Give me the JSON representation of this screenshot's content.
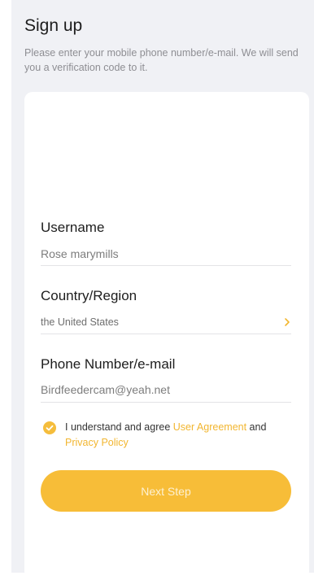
{
  "header": {
    "title": "Sign up",
    "subtitle": "Please enter your mobile phone number/e-mail. We will send you a verification code to it."
  },
  "form": {
    "username": {
      "label": "Username",
      "value": "Rose marymills"
    },
    "country": {
      "label": "Country/Region",
      "value": "the United States",
      "icon": "chevron-right-icon"
    },
    "phone_email": {
      "label": "Phone Number/e-mail",
      "value": "Birdfeedercam@yeah.net"
    },
    "agreement": {
      "checked": true,
      "text_prefix": "I understand and agree ",
      "user_agreement": "User Agreement",
      "text_and": " and ",
      "privacy_policy": "Privacy Policy"
    },
    "next_label": "Next Step"
  },
  "colors": {
    "accent": "#f7bd38",
    "link": "#f2b630",
    "background": "#f0f1f5"
  }
}
